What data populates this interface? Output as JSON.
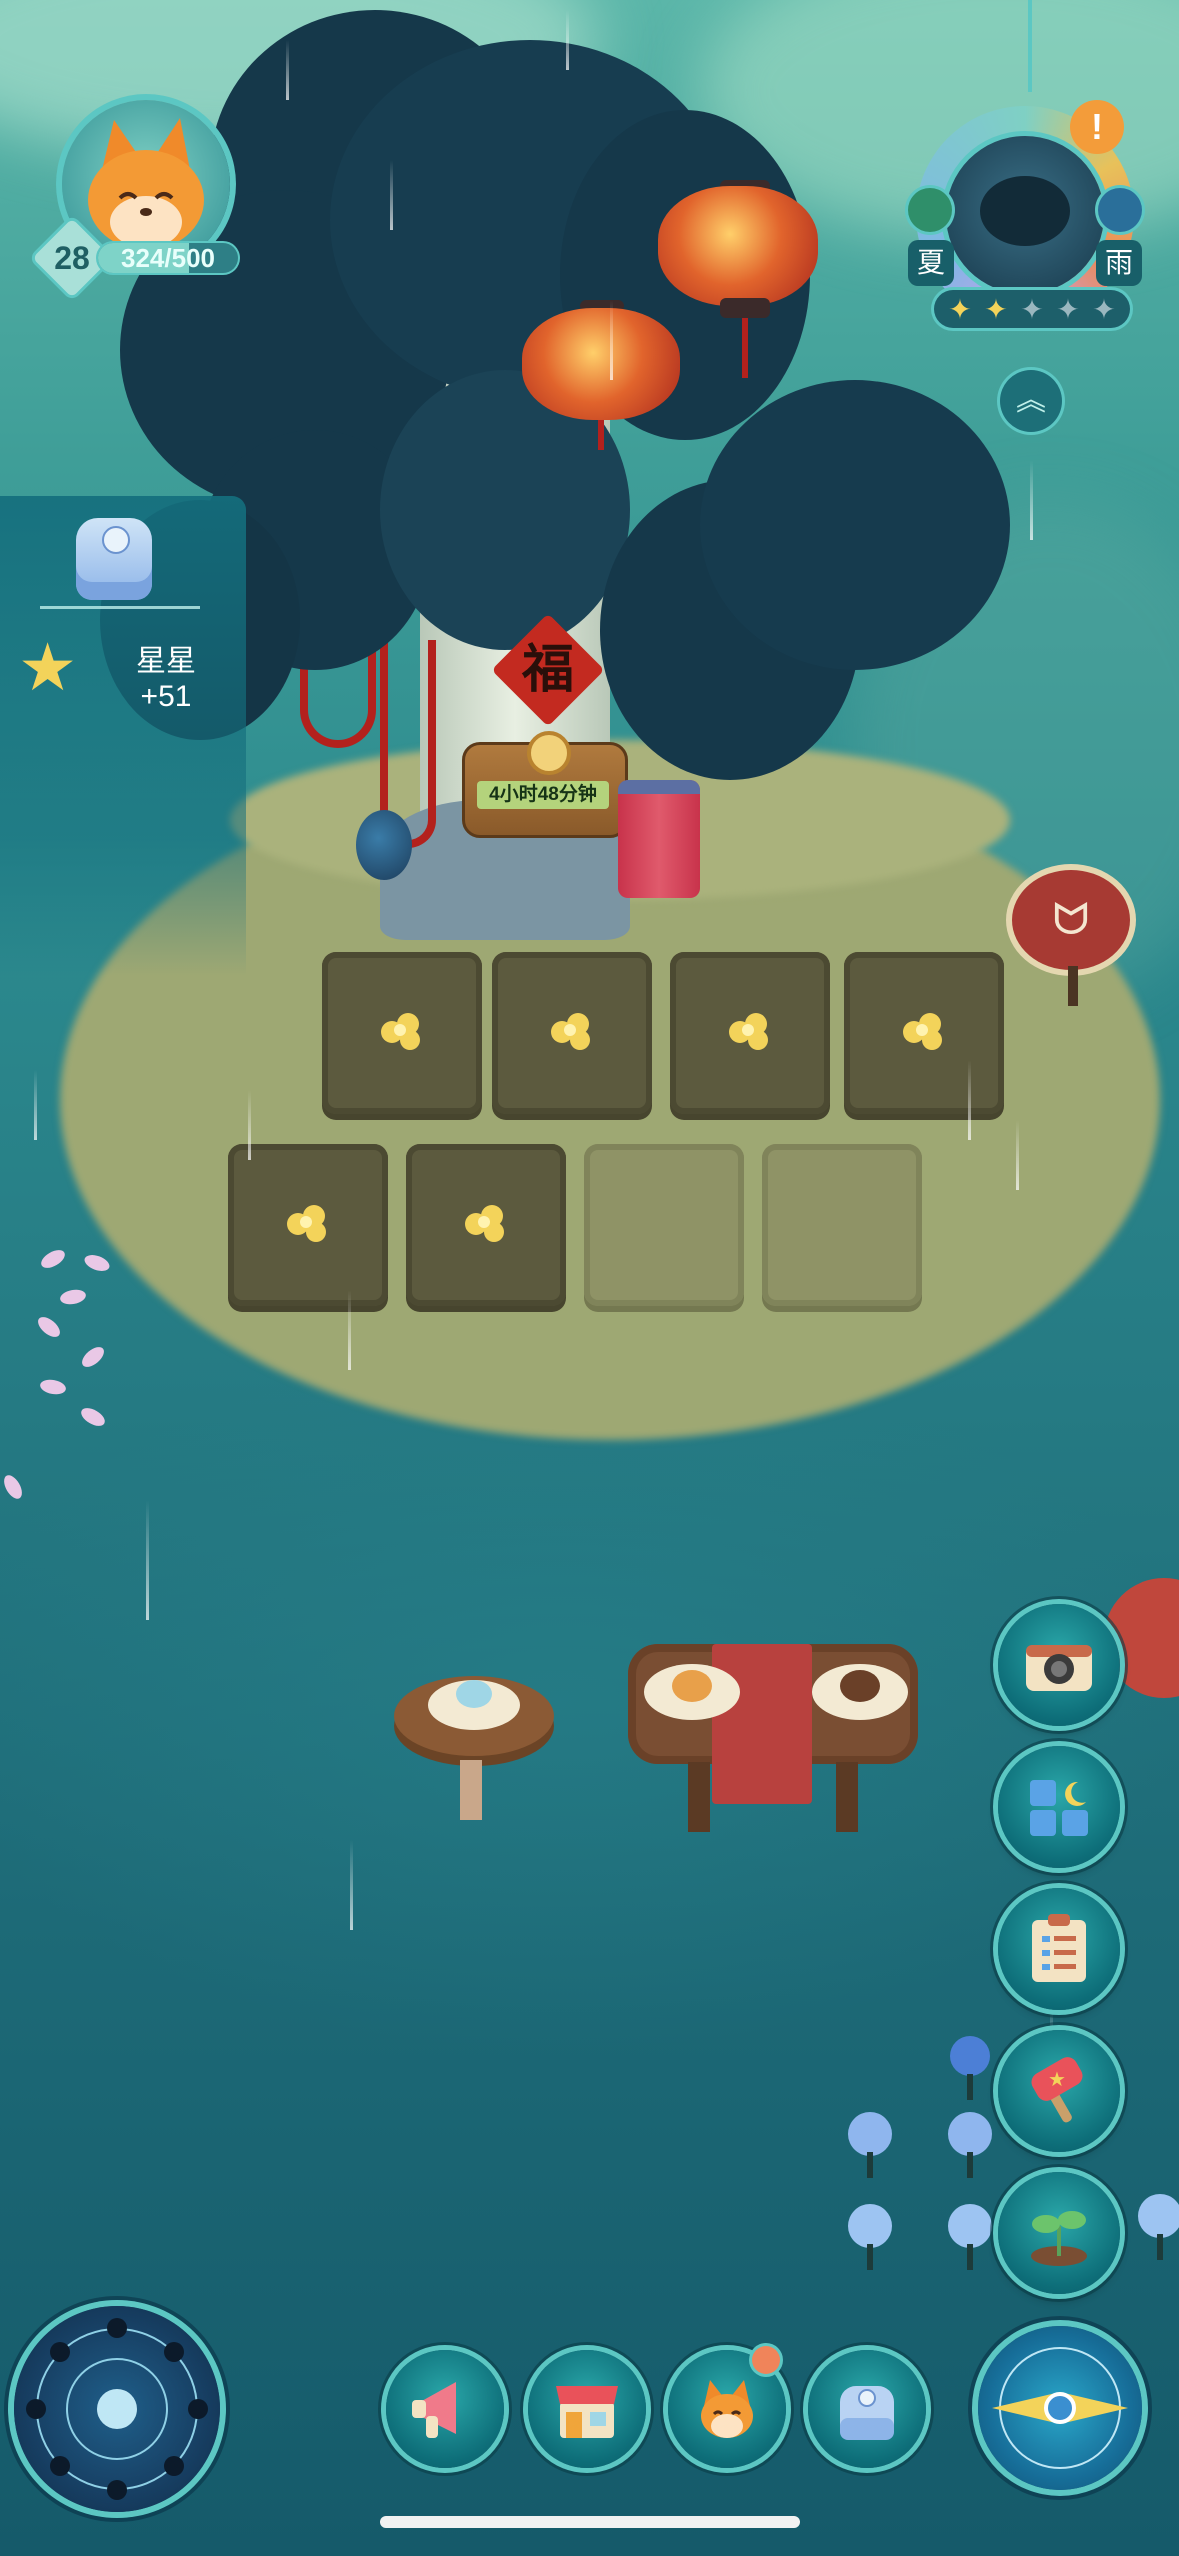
{
  "player": {
    "level": "28",
    "exp": "324/500",
    "exp_fraction": 0.648
  },
  "weather": {
    "season": "夏",
    "condition": "雨",
    "alert_icon": "exclamation-icon",
    "stars_filled": 2,
    "stars_total": 5
  },
  "side_panel": {
    "reward_name": "星星",
    "reward_amount": "+51"
  },
  "tree_sign": {
    "fu_char": "福",
    "timer": "4小时48分钟"
  },
  "farm": {
    "plots": [
      {
        "state": "sprout"
      },
      {
        "state": "sprout"
      },
      {
        "state": "sprout"
      },
      {
        "state": "sprout"
      },
      {
        "state": "sprout"
      },
      {
        "state": "sprout"
      },
      {
        "state": "empty"
      },
      {
        "state": "empty"
      }
    ]
  },
  "right_buttons": [
    {
      "name": "camera-button",
      "icon": "camera-icon"
    },
    {
      "name": "decorate-button",
      "icon": "blocks-moon-icon"
    },
    {
      "name": "tasks-button",
      "icon": "clipboard-icon"
    },
    {
      "name": "event-button",
      "icon": "hammer-icon"
    },
    {
      "name": "plant-button",
      "icon": "sprout-icon"
    }
  ],
  "bottom_buttons": [
    {
      "name": "announcement-button",
      "icon": "megaphone-icon"
    },
    {
      "name": "shop-button",
      "icon": "shop-icon"
    },
    {
      "name": "friends-button",
      "icon": "fox-icon",
      "has_notification": true
    },
    {
      "name": "backpack-button",
      "icon": "backpack-icon"
    }
  ],
  "colors": {
    "accent_teal": "#5cc7c3",
    "exp_bar": "#7ed3c8",
    "sprout_yellow": "#f3d35a",
    "lantern_red": "#d1402a",
    "notification_orange": "#f39c3a"
  }
}
